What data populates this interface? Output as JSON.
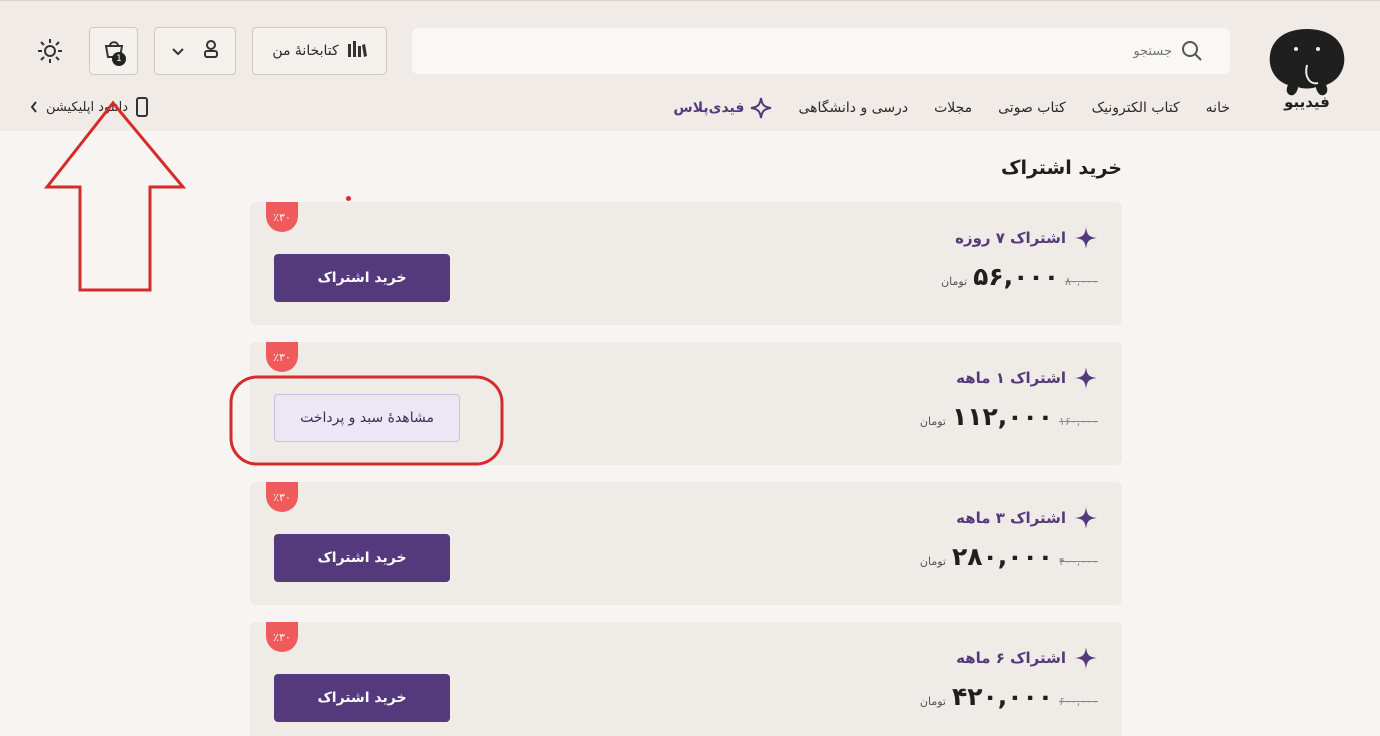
{
  "header": {
    "logo_text": "فیدیبو",
    "search_placeholder": "جستجو",
    "library_label": "کتابخانهٔ من",
    "cart_count": "1",
    "nav": [
      {
        "label": "خانه"
      },
      {
        "label": "کتاب الکترونیک"
      },
      {
        "label": "کتاب صوتی"
      },
      {
        "label": "مجلات"
      },
      {
        "label": "درسی و دانشگاهی"
      }
    ],
    "plus_label": "فیدی‌پلاس",
    "app_download": "دانلود اپلیکیشن"
  },
  "main": {
    "title": "خرید اشتراک",
    "plans": [
      {
        "name": "اشتراک ۷ روزه",
        "old_price": "۸۰,۰۰۰",
        "price": "۵۶,۰۰۰",
        "currency": "تومان",
        "discount": "٪۳۰",
        "action": "خرید اشتراک",
        "in_cart": false
      },
      {
        "name": "اشتراک ۱ ماهه",
        "old_price": "۱۶۰,۰۰۰",
        "price": "۱۱۲,۰۰۰",
        "currency": "تومان",
        "discount": "٪۳۰",
        "action": "مشاهدهٔ سبد و پرداخت",
        "in_cart": true
      },
      {
        "name": "اشتراک ۳ ماهه",
        "old_price": "۴۰۰,۰۰۰",
        "price": "۲۸۰,۰۰۰",
        "currency": "تومان",
        "discount": "٪۳۰",
        "action": "خرید اشتراک",
        "in_cart": false
      },
      {
        "name": "اشتراک ۶ ماهه",
        "old_price": "۶۰۰,۰۰۰",
        "price": "۴۲۰,۰۰۰",
        "currency": "تومان",
        "discount": "٪۳۰",
        "action": "خرید اشتراک",
        "in_cart": false
      }
    ]
  },
  "colors": {
    "brand_purple": "#55397d",
    "discount_red": "#ef5a5a",
    "annotation_red": "#d52b2b",
    "header_bg": "#f0ebe6",
    "card_bg": "#efebe7"
  }
}
